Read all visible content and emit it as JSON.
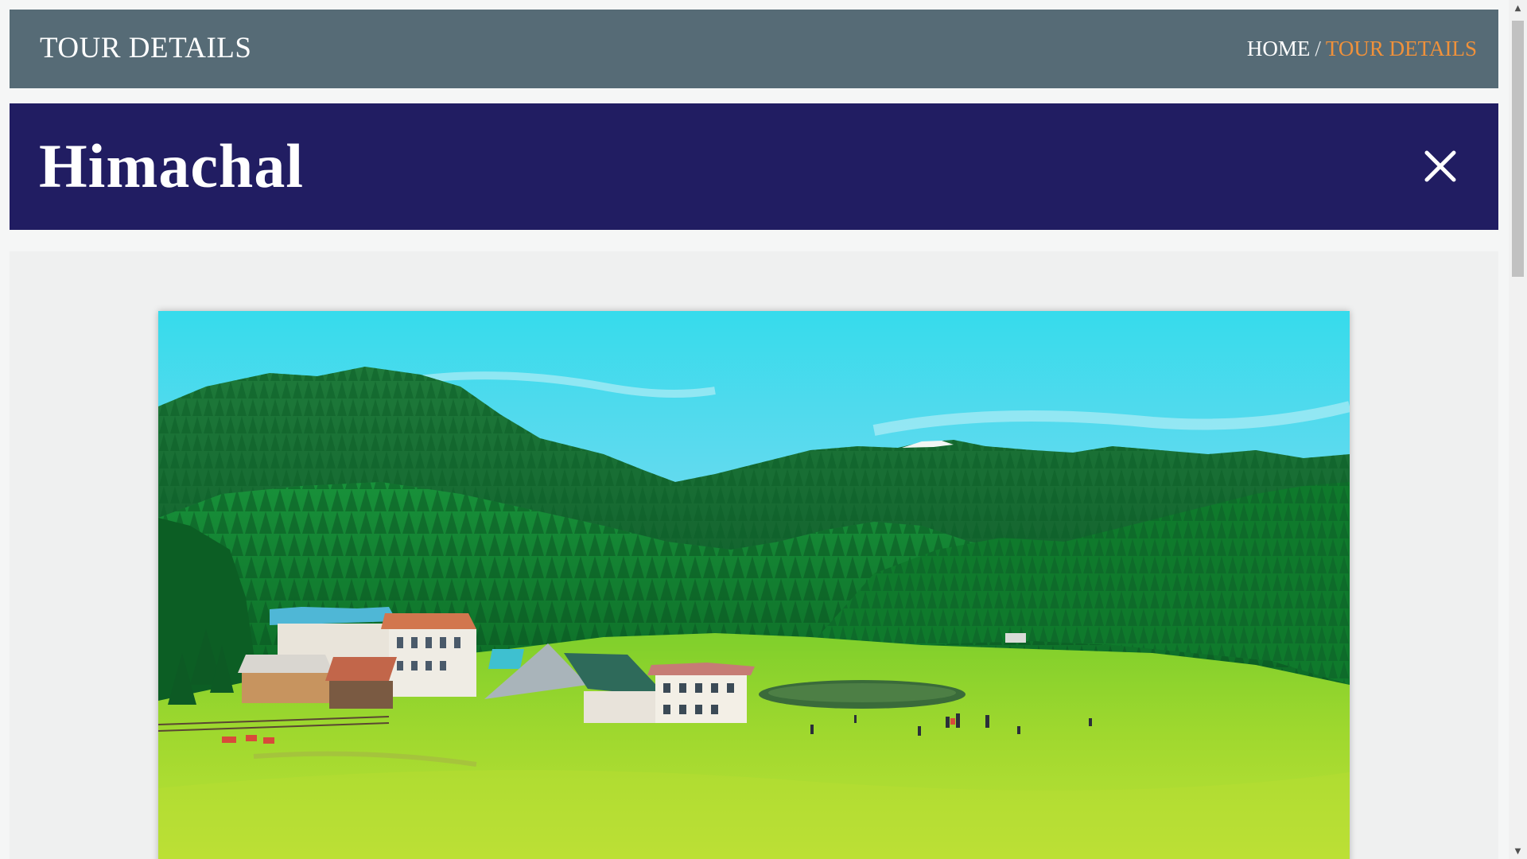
{
  "header": {
    "title": "TOUR DETAILS",
    "breadcrumb": {
      "home": "HOME",
      "separator": "/",
      "current": "TOUR DETAILS"
    }
  },
  "tour": {
    "name": "Himachal",
    "close_icon": "close-icon"
  },
  "image": {
    "alt": "Himachal"
  },
  "scrollbar": {
    "up_arrow": "▲",
    "down_arrow": "▼"
  },
  "colors": {
    "header_bg": "#566b76",
    "banner_bg": "#211d62",
    "breadcrumb_active": "#f0913a"
  }
}
